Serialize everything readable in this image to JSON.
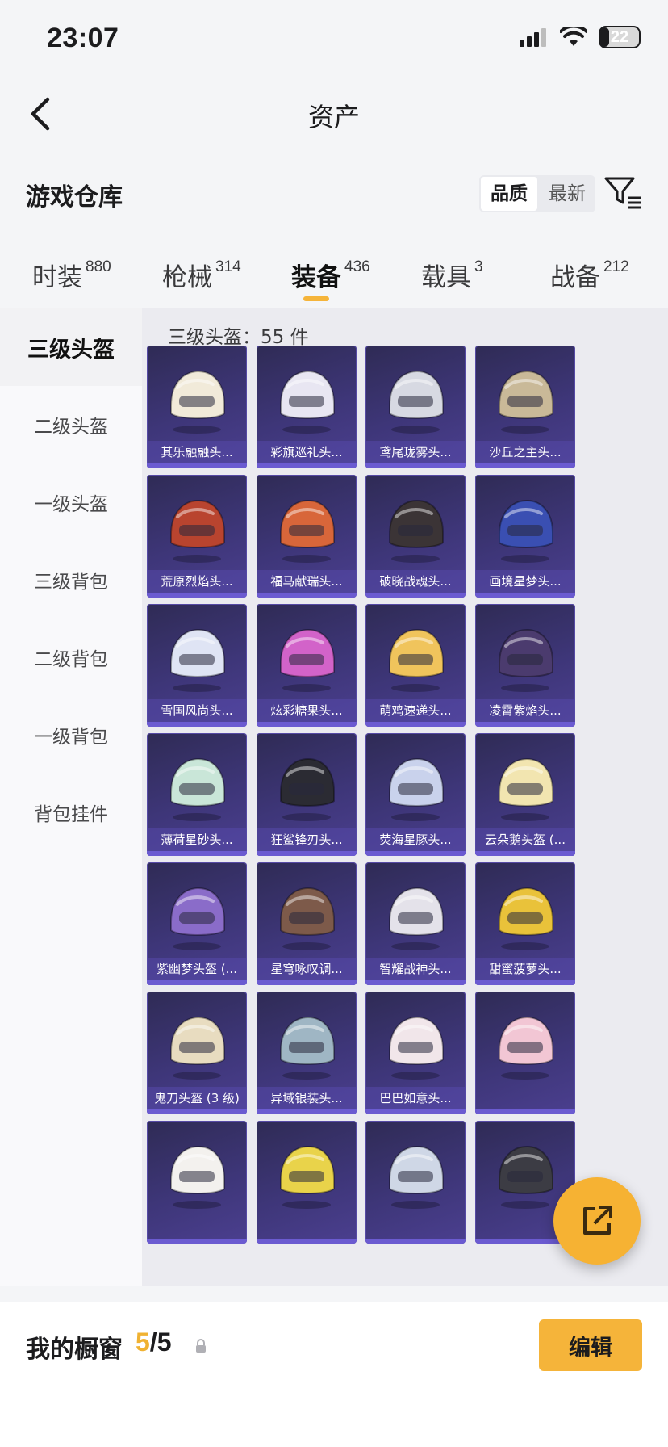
{
  "status_bar": {
    "time": "23:07",
    "battery_level": "22",
    "battery_fraction": 0.22
  },
  "nav": {
    "title": "资产"
  },
  "section": {
    "title": "游戏仓库",
    "sort_options": [
      "品质",
      "最新"
    ],
    "sort_active_index": 0
  },
  "category_tabs": [
    {
      "label": "时装",
      "count": "880"
    },
    {
      "label": "枪械",
      "count": "314"
    },
    {
      "label": "装备",
      "count": "436"
    },
    {
      "label": "载具",
      "count": "3"
    },
    {
      "label": "战备",
      "count": "212"
    }
  ],
  "active_category_index": 2,
  "sidebar": {
    "items": [
      "三级头盔",
      "二级头盔",
      "一级头盔",
      "三级背包",
      "二级背包",
      "一级背包",
      "背包挂件"
    ],
    "active_index": 0
  },
  "grid": {
    "header": "三级头盔：55 件",
    "items": [
      {
        "label": "其乐融融头...",
        "color": "#f1ead9"
      },
      {
        "label": "彩旗巡礼头...",
        "color": "#e8e6f2"
      },
      {
        "label": "鸢尾珑雾头...",
        "color": "#d7d9e2"
      },
      {
        "label": "沙丘之主头...",
        "color": "#c9b998"
      },
      {
        "label": "荒原烈焰头...",
        "color": "#b9442f"
      },
      {
        "label": "福马献瑞头...",
        "color": "#d8663a"
      },
      {
        "label": "破晓战魂头...",
        "color": "#3b3436"
      },
      {
        "label": "画境星梦头...",
        "color": "#3a4fb2"
      },
      {
        "label": "雪国风尚头...",
        "color": "#dfe4f4"
      },
      {
        "label": "炫彩糖果头...",
        "color": "#d263c9"
      },
      {
        "label": "萌鸡速递头...",
        "color": "#f0c45c"
      },
      {
        "label": "凌霄紫焰头...",
        "color": "#4b3b6e"
      },
      {
        "label": "薄荷星砂头...",
        "color": "#c9e6d8"
      },
      {
        "label": "狂鲨锋刃头...",
        "color": "#2b2b33"
      },
      {
        "label": "荧海星豚头...",
        "color": "#c9d2ec"
      },
      {
        "label": "云朵鹅头盔 (...",
        "color": "#f2e5b0"
      },
      {
        "label": "紫幽梦头盔 (...",
        "color": "#8a6cc9"
      },
      {
        "label": "星穹咏叹调...",
        "color": "#7d5a4a"
      },
      {
        "label": "智耀战神头...",
        "color": "#e4e2ea"
      },
      {
        "label": "甜蜜菠萝头...",
        "color": "#e9c23a"
      },
      {
        "label": "鬼刀头盔 (3 级)",
        "color": "#e8dcc0"
      },
      {
        "label": "异域银装头...",
        "color": "#9fb6c4"
      },
      {
        "label": "巴巴如意头...",
        "color": "#f1e6ea"
      },
      {
        "label": "",
        "color": "#f2c6d4"
      },
      {
        "label": "",
        "color": "#f3f1ee"
      },
      {
        "label": "",
        "color": "#e9d34a"
      },
      {
        "label": "",
        "color": "#cfd7e6"
      },
      {
        "label": "",
        "color": "#3c3c44"
      }
    ]
  },
  "bottom_bar": {
    "label": "我的橱窗",
    "count_current": "5",
    "count_total": "/5",
    "edit_label": "编辑"
  },
  "colors": {
    "accent": "#f5b43a",
    "tile_bg": "#3e3679"
  }
}
